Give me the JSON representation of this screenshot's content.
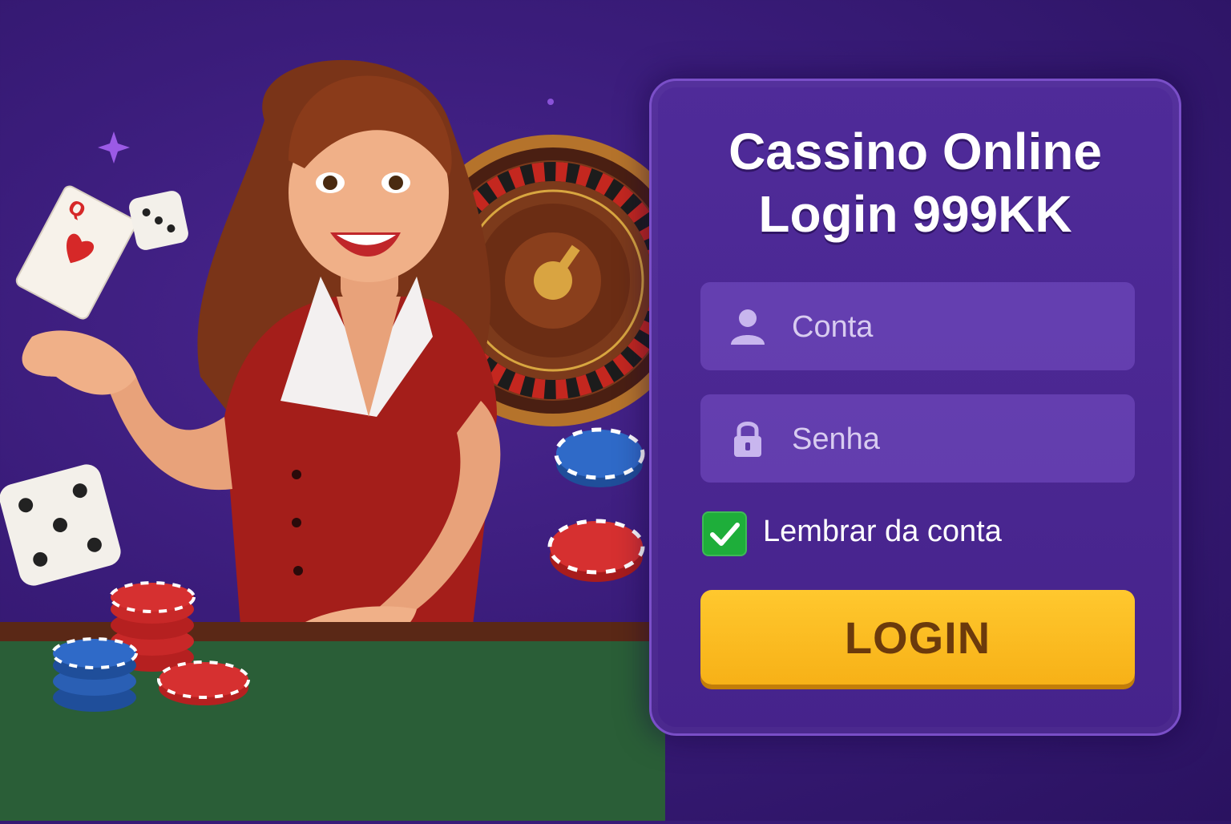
{
  "title_line1": "Cassino Online",
  "title_line2": "Login 999KK",
  "account_field": {
    "placeholder": "Conta",
    "icon": "user-icon"
  },
  "password_field": {
    "placeholder": "Senha",
    "icon": "lock-icon"
  },
  "remember": {
    "label": "Lembrar da conta",
    "checked": true
  },
  "login_button": {
    "label": "LOGIN"
  },
  "playing_card": {
    "rank": "Q"
  },
  "colors": {
    "background": "#3a1c7a",
    "panel": "#4a268f",
    "field": "#5e3aa8",
    "button": "#fbbb1f",
    "button_text": "#6b3a0c",
    "checkbox": "#1eae3a"
  }
}
